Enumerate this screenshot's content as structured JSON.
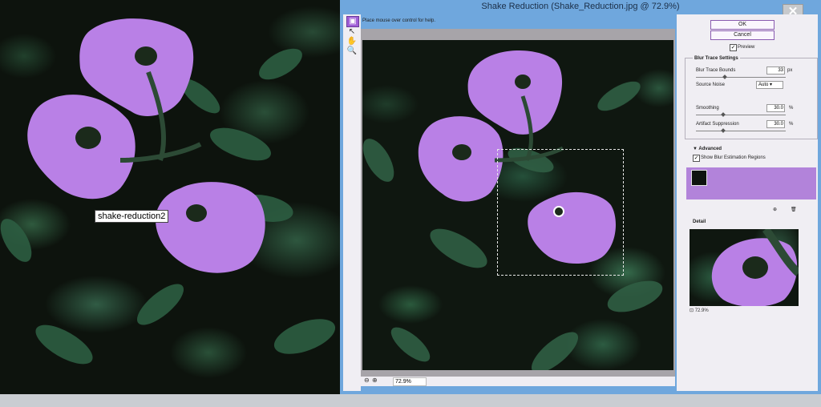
{
  "tooltip": "shake-reduction2",
  "dialog": {
    "title": "Shake Reduction (Shake_Reduction.jpg @ 72.9%)",
    "close_glyph": "✕",
    "help_text": "Place mouse over control for help.",
    "zoom_value": "72.9%"
  },
  "panel": {
    "ok": "OK",
    "cancel": "Cancel",
    "preview_label": "Preview",
    "preview_checked": "✓",
    "blur_trace_settings": "Blur Trace Settings",
    "blur_trace_bounds_label": "Blur Trace Bounds",
    "blur_trace_bounds_value": "33",
    "blur_trace_bounds_unit": "px",
    "source_noise_label": "Source Noise",
    "source_noise_value": "Auto",
    "smoothing_label": "Smoothing",
    "smoothing_value": "30.0",
    "smoothing_unit": "%",
    "artifact_label": "Artifact Suppression",
    "artifact_value": "30.0",
    "artifact_unit": "%",
    "advanced": "Advanced",
    "show_regions_label": "Show Blur Estimation Regions",
    "show_regions_checked": "✓",
    "detail": "Detail",
    "detail_zoom": "72.9%"
  },
  "colors": {
    "petal": "#b980e6",
    "dialog_border": "#6fa7dd",
    "accent": "#a05fd6"
  }
}
